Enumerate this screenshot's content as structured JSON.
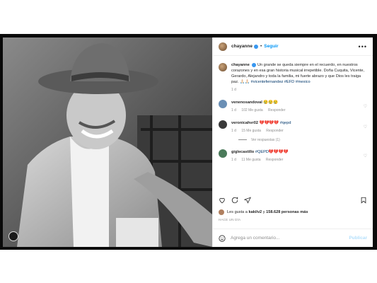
{
  "header": {
    "username": "chayanne",
    "separator": "•",
    "follow_label": "Seguir",
    "more_label": "•••"
  },
  "caption": {
    "username": "chayanne",
    "text": "Un grande se queda siempre en el recuerdo, en nuestros corazones y en esa gran historia musical irrepetible. Doña Cuquita, Vicente, Gerardo, Alejandro y toda la familia, mi fuerte abrazo y que Dios les traiga paz.",
    "emoji": "🙏🏻🙏🏻",
    "tags": "#vicentefernandez #EFD #mexico",
    "time": "1 d"
  },
  "comments": [
    {
      "username": "venenosandoval",
      "text": "😢😢😢",
      "time": "1 d",
      "likes": "102 Me gusta",
      "reply": "Responder",
      "avatar_color": "#6a8fb5"
    },
    {
      "username": "veronicahvr02",
      "text": "💔💔💔💔 #qepd",
      "time": "1 d",
      "likes": "15 Me gusta",
      "reply": "Responder",
      "avatar_color": "#3a3a3a"
    },
    {
      "username": "giglecastillo",
      "text": "#QEPD💔💔💔💔",
      "time": "1 d",
      "likes": "11 Me gusta",
      "reply": "Responder",
      "avatar_color": "#4a7a5a"
    }
  ],
  "view_replies": "Ver respuestas (1)",
  "likes": {
    "text_prefix": "Les gusta a",
    "user": "kakilv2",
    "text_mid": "y",
    "count": "158.628 personas más"
  },
  "posted_ago": "HACE UN DÍA",
  "add_comment": {
    "placeholder": "Agrega un comentario...",
    "publish_label": "Publicar"
  },
  "colors": {
    "link": "#00376b",
    "follow": "#0095f6",
    "meta": "#8e8e8e"
  }
}
